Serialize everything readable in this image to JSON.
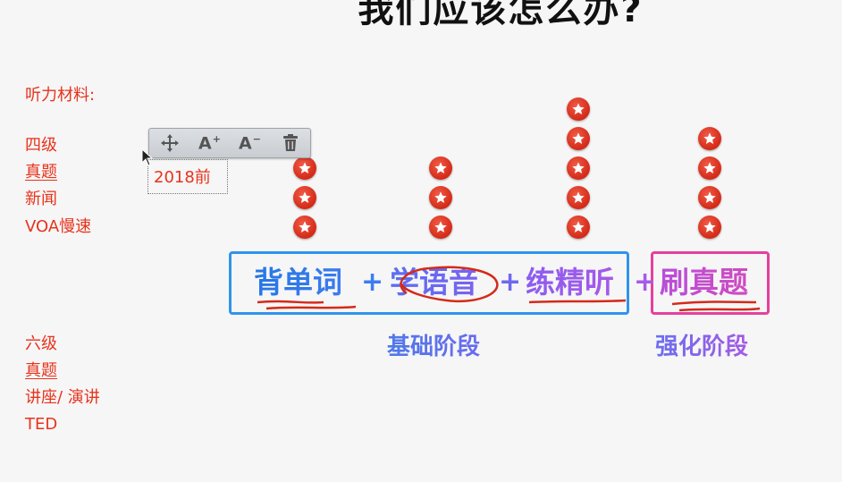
{
  "title": "我们应该怎么办?",
  "left_panel": {
    "heading": "听力材料:",
    "cet4": {
      "level": "四级",
      "items": [
        "真题",
        "新闻",
        "VOA慢速"
      ]
    },
    "cet6": {
      "level": "六级",
      "items": [
        "真题",
        "讲座/ 演讲",
        "TED"
      ]
    }
  },
  "toolbar": {
    "move_icon": "move-icon",
    "increase_font_label": "A",
    "increase_font_suffix": "+",
    "decrease_font_label": "A",
    "decrease_font_suffix": "−",
    "delete_icon": "trash-icon"
  },
  "textbox": {
    "value": "2018前"
  },
  "steps": [
    {
      "label": "背单词",
      "stars": 3
    },
    {
      "label": "学语音",
      "stars": 3
    },
    {
      "label": "练精听",
      "stars": 5
    },
    {
      "label": "刷真题",
      "stars": 4
    }
  ],
  "operator": "+",
  "stages": {
    "basic": "基础阶段",
    "advanced": "强化阶段"
  },
  "colors": {
    "accent_red": "#e8331c",
    "blue_box": "#2f94ec",
    "pink_box": "#e6409d",
    "ink_annotation": "#d42a1a"
  }
}
